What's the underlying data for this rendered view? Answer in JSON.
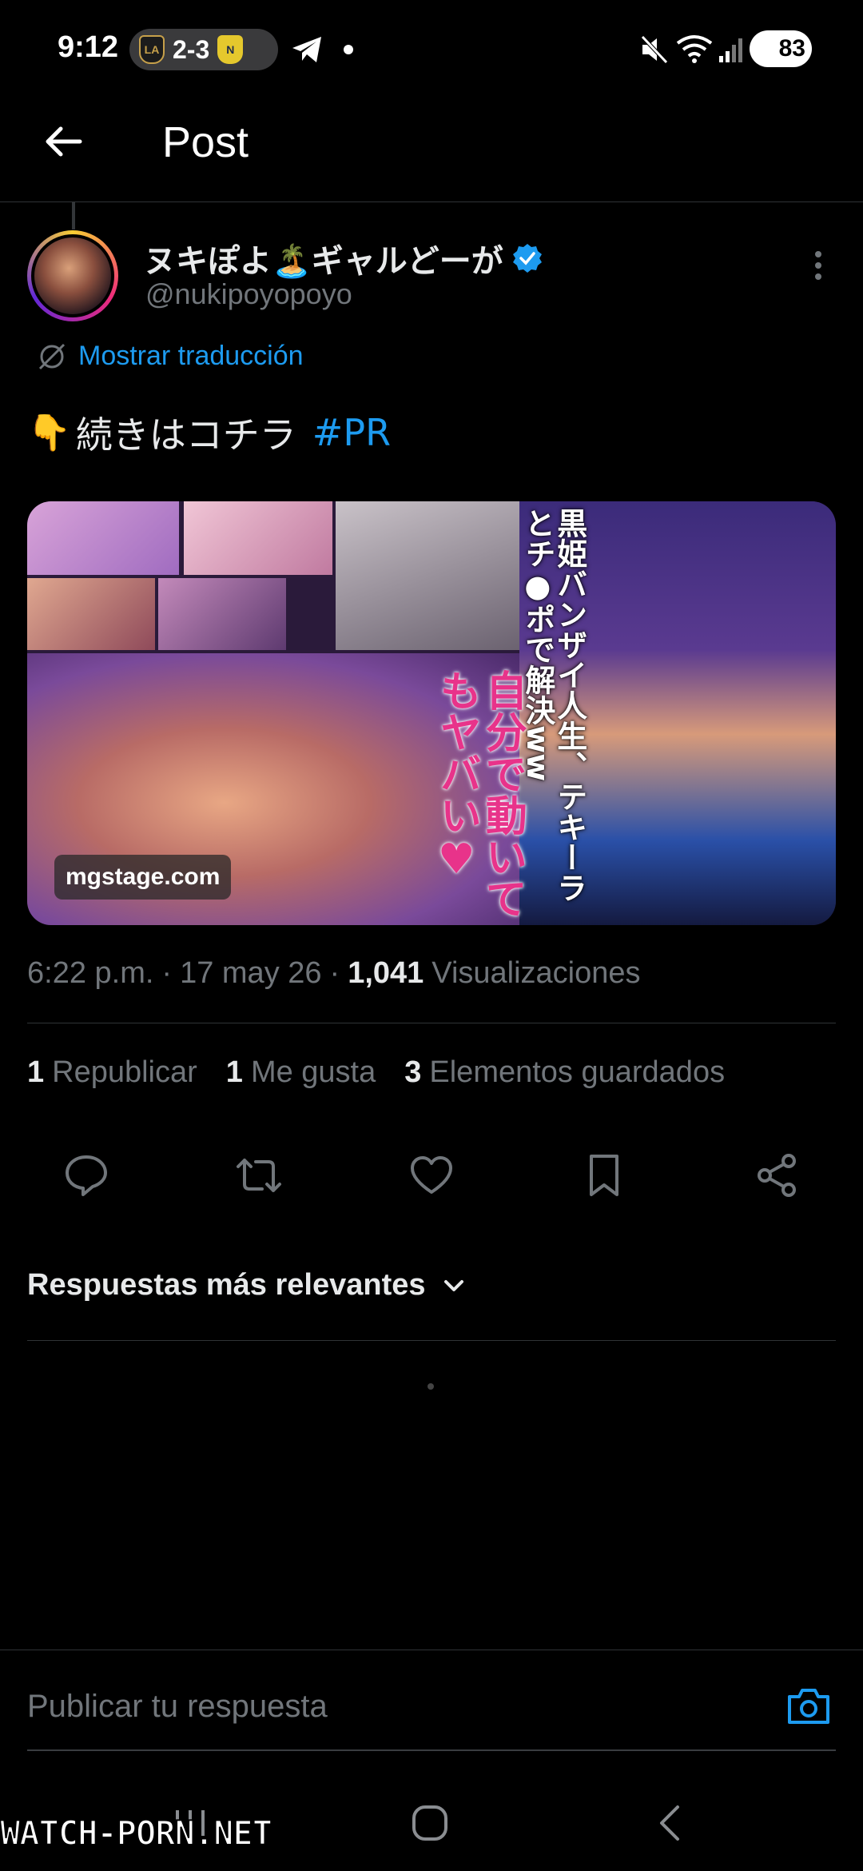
{
  "status_bar": {
    "time": "9:12",
    "score": "2-3",
    "battery": "83"
  },
  "header": {
    "title": "Post"
  },
  "post": {
    "author": {
      "display_name": "ヌキぽよ🏝️ギャルどーが",
      "handle": "@nukipoyopoyo",
      "verified": true
    },
    "translate_label": "Mostrar traducción",
    "text": "続きはコチラ",
    "hashtag": "#PR",
    "media": {
      "overlay_text_1": "黒姫バンザイ人生、テキーラとチ●ポで解決ww",
      "overlay_text_2": "自分で動いてもヤバい♥",
      "watermark": "mgstage.com"
    },
    "meta": {
      "time": "6:22 p.m.",
      "date": "17 may 26",
      "views_count": "1,041",
      "views_label": "Visualizaciones"
    },
    "stats": [
      {
        "count": "1",
        "label": "Republicar"
      },
      {
        "count": "1",
        "label": "Me gusta"
      },
      {
        "count": "3",
        "label": "Elementos guardados"
      }
    ]
  },
  "replies": {
    "filter_label": "Respuestas más relevantes"
  },
  "composer": {
    "placeholder": "Publicar tu respuesta"
  },
  "site_watermark": "WATCH-PORN.NET",
  "colors": {
    "background": "#000000",
    "accent": "#1d9bf0",
    "text_primary": "#e7e9ea",
    "text_secondary": "#71767b",
    "divider": "#2f3336"
  }
}
